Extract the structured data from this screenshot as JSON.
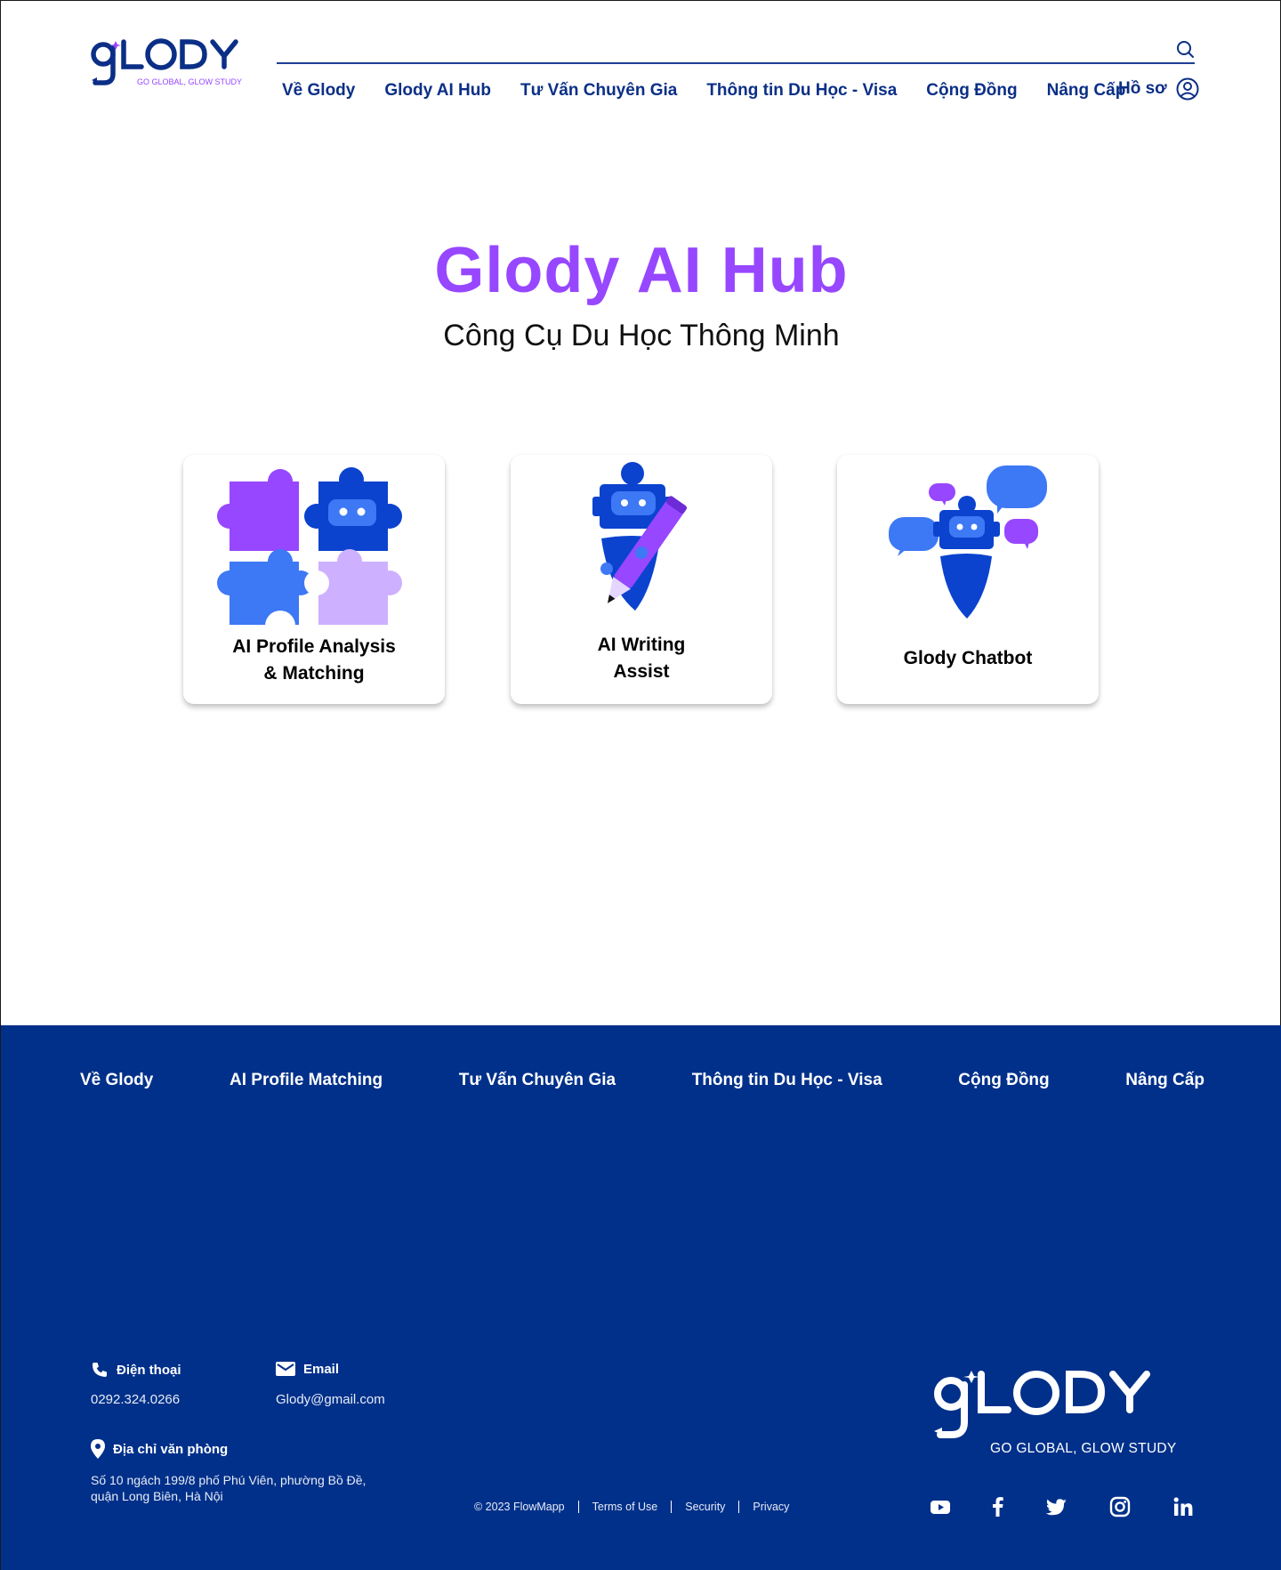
{
  "brand": {
    "name": "GLODY",
    "tagline": "GO GLOBAL, GLOW STUDY",
    "color_primary": "#0b2f86",
    "color_accent": "#9747ff",
    "color_footer": "#00308a"
  },
  "header": {
    "search": {
      "icon": "search-icon"
    },
    "nav": [
      {
        "label": "Về Glody"
      },
      {
        "label": "Glody AI Hub"
      },
      {
        "label": "Tư Vấn Chuyên Gia"
      },
      {
        "label": "Thông tin Du Học - Visa"
      },
      {
        "label": "Cộng Đồng"
      },
      {
        "label": "Nâng Cấp"
      }
    ],
    "profile": {
      "label": "Hồ sơ",
      "icon": "user-circle-icon"
    }
  },
  "hero": {
    "title": "Glody AI Hub",
    "subtitle": "Công Cụ Du Học Thông Minh"
  },
  "tools": [
    {
      "label": "AI Profile Analysis\n& Matching",
      "icon": "puzzle-robot-icon"
    },
    {
      "label": "AI Writing\nAssist",
      "icon": "robot-pencil-icon"
    },
    {
      "label": "Glody Chatbot",
      "icon": "robot-chat-icon"
    }
  ],
  "footer": {
    "nav": [
      {
        "label": "Về Glody"
      },
      {
        "label": "AI Profile Matching"
      },
      {
        "label": "Tư Vấn Chuyên Gia"
      },
      {
        "label": "Thông tin Du Học - Visa"
      },
      {
        "label": "Cộng Đồng"
      },
      {
        "label": "Nâng Cấp"
      }
    ],
    "contact": {
      "phone_label": "Điện thoại",
      "phone_value": "0292.324.0266",
      "email_label": "Email",
      "email_value": "Glody@gmail.com",
      "address_label": "Địa chỉ văn phòng",
      "address_value": "Số 10 ngách 199/8 phố Phú Viên, phường Bồ Đề, quận Long Biên, Hà Nội"
    },
    "legal": {
      "copyright": "© 2023 FlowMapp",
      "terms": "Terms of Use",
      "security": "Security",
      "privacy": "Privacy"
    },
    "social": [
      "youtube-icon",
      "facebook-icon",
      "twitter-icon",
      "instagram-icon",
      "linkedin-icon"
    ]
  }
}
